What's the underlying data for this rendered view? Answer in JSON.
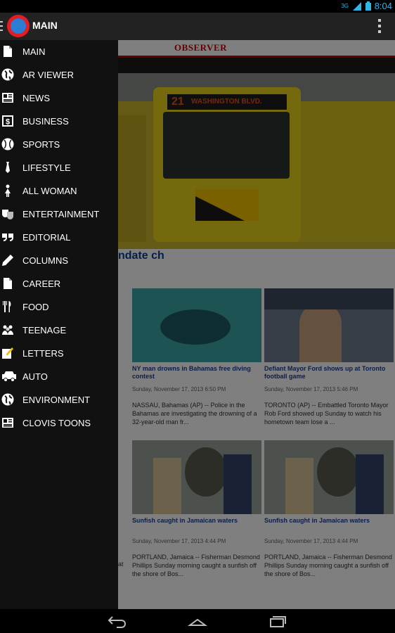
{
  "status_bar": {
    "signal": "3G",
    "time": "8:04"
  },
  "action_bar": {
    "title": "MAIN"
  },
  "drawer": {
    "items": [
      {
        "label": "MAIN",
        "icon": "document-icon"
      },
      {
        "label": "AR VIEWER",
        "icon": "globe-icon"
      },
      {
        "label": "NEWS",
        "icon": "newspaper-icon"
      },
      {
        "label": "BUSINESS",
        "icon": "dollar-icon"
      },
      {
        "label": "SPORTS",
        "icon": "baseball-icon"
      },
      {
        "label": "LIFESTYLE",
        "icon": "tie-icon"
      },
      {
        "label": "ALL WOMAN",
        "icon": "woman-icon"
      },
      {
        "label": "ENTERTAINMENT",
        "icon": "theater-masks-icon"
      },
      {
        "label": "EDITORIAL",
        "icon": "quote-icon"
      },
      {
        "label": "COLUMNS",
        "icon": "pencil-icon"
      },
      {
        "label": "CAREER",
        "icon": "document-icon"
      },
      {
        "label": "FOOD",
        "icon": "fork-knife-icon"
      },
      {
        "label": "TEENAGE",
        "icon": "teens-icon"
      },
      {
        "label": "LETTERS",
        "icon": "letter-pen-icon"
      },
      {
        "label": "AUTO",
        "icon": "car-icon"
      },
      {
        "label": "ENVIRONMENT",
        "icon": "globe-icon"
      },
      {
        "label": "CLOVIS TOONS",
        "icon": "newspaper-icon"
      }
    ]
  },
  "content": {
    "masthead": "OBSERVER",
    "hero_route": {
      "number": "21",
      "destination": "WASHINGTON BLVD."
    },
    "hero_headline": "ndate ch",
    "cards": [
      {
        "title": "NY man drowns in Bahamas free diving contest",
        "date": "Sunday, November 17, 2013 6:50 PM",
        "summary": "NASSAU, Bahamas (AP) -- Police in the Bahamas are investigating the drowning of a 32-year-old man fr..."
      },
      {
        "title": "Defiant Mayor Ford shows up at Toronto football game",
        "date": "Sunday, November 17, 2013 5:46 PM",
        "summary": "TORONTO (AP) -- Embattled Toronto Mayor Rob Ford showed up Sunday to watch his hometown team lose a ..."
      },
      {
        "title": "Sunfish caught in Jamaican waters",
        "date": "Sunday, November 17, 2013 4:44 PM",
        "summary": "PORTLAND, Jamaica -- Fisherman Desmond Phillips Sunday morning caught a sunfish off the shore of Bos..."
      },
      {
        "title": "Sunfish caught in Jamaican waters",
        "date": "Sunday, November 17, 2013 4:44 PM",
        "summary": "PORTLAND, Jamaica -- Fisherman Desmond Phillips Sunday morning caught a sunfish off the shore of Bos..."
      }
    ],
    "left_fragment": "at"
  },
  "nav_bar": {
    "icons": [
      "back-icon",
      "home-icon",
      "recent-apps-icon"
    ]
  },
  "colors": {
    "accent": "#33b5e5",
    "brand_red": "#e31d22",
    "link_blue": "#1a3c93",
    "drawer_bg": "#111111"
  }
}
